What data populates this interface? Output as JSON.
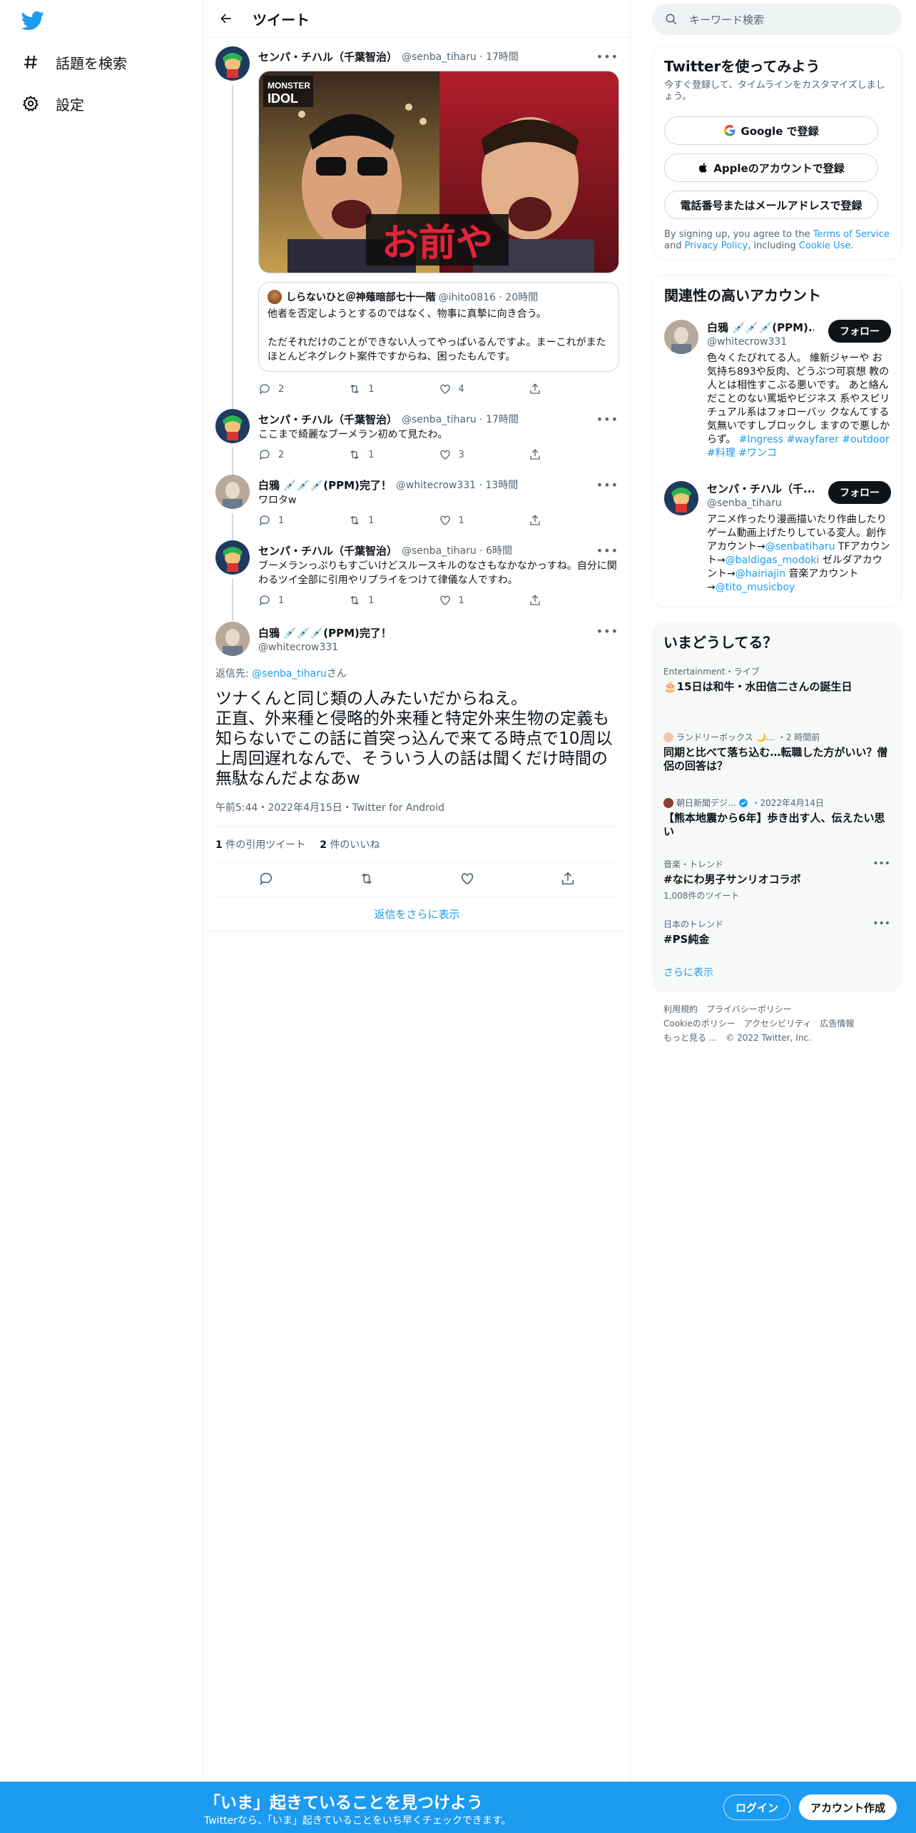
{
  "nav": {
    "logo": "twitter-bird",
    "items": [
      {
        "label": "話題を検索",
        "icon": "hashtag-icon"
      },
      {
        "label": "設定",
        "icon": "gear-icon"
      }
    ]
  },
  "header": {
    "title": "ツイート"
  },
  "thread": [
    {
      "name": "センパ・チハル（千葉智治）",
      "handle": "@senba_tiharu",
      "time": "17時間",
      "image_text": "お前や",
      "image_badge": "MONSTER IDOL",
      "quote": {
        "name": "しらないひと＠神薙暗部七十一階",
        "handle": "@ihito0816",
        "time": "20時間",
        "text": "他者を否定しようとするのではなく、物事に真摯に向き合う。\n\nただそれだけのことができない人ってやっぱいるんですよ。まーこれがまたほとんどネグレクト案件ですからね、困ったもんです。"
      },
      "replies": "2",
      "retweets": "1",
      "likes": "4"
    },
    {
      "name": "センパ・チハル（千葉智治）",
      "handle": "@senba_tiharu",
      "time": "17時間",
      "text": "ここまで綺麗なブーメラン初めて見たわ。",
      "replies": "2",
      "retweets": "1",
      "likes": "3"
    },
    {
      "name": "白鴉 💉💉💉(PPM)完了！",
      "handle": "@whitecrow331",
      "time": "13時間",
      "text": "ワロタw",
      "replies": "1",
      "retweets": "1",
      "likes": "1"
    },
    {
      "name": "センパ・チハル（千葉智治）",
      "handle": "@senba_tiharu",
      "time": "6時間",
      "text": "ブーメランっぷりもすごいけどスルースキルのなさもなかなかっすね。自分に関わるツイ全部に引用やリプライをつけて律儀な人ですわ。",
      "replies": "1",
      "retweets": "1",
      "likes": "1"
    }
  ],
  "focus": {
    "name": "白鴉 💉💉💉(PPM)完了！",
    "handle": "@whitecrow331",
    "reply_to_prefix": "返信先: ",
    "reply_to_handle": "@senba_tiharu",
    "reply_to_suffix": "さん",
    "text": "ツナくんと同じ類の人みたいだからねえ。\n正直、外来種と侵略的外来種と特定外来生物の定義も知らないでこの話に首突っ込んで来てる時点で10周以上周回遅れなんで、そういう人の話は聞くだけ時間の無駄なんだよなあw",
    "meta": "午前5:44・2022年4月15日・Twitter for Android",
    "quote_count": "1",
    "quote_label": "件の引用ツイート",
    "like_count": "2",
    "like_label": "件のいいね"
  },
  "show_more_replies": "返信をさらに表示",
  "right": {
    "search_placeholder": "キーワード検索",
    "signup": {
      "title": "Twitterを使ってみよう",
      "sub": "今すぐ登録して、タイムラインをカスタマイズしましょう。",
      "google": "Google で登録",
      "apple": "Appleのアカウントで登録",
      "phone": "電話番号またはメールアドレスで登録",
      "fine_1": "By signing up, you agree to the ",
      "terms": "Terms of Service",
      "fine_2": " and ",
      "privacy": "Privacy Policy",
      "fine_3": ", including ",
      "cookie": "Cookie Use",
      "fine_4": "."
    },
    "related": {
      "title": "関連性の高いアカウント",
      "follow_label": "フォロー",
      "accounts": [
        {
          "name": "白鴉 💉💉💉(PPM)...",
          "handle": "@whitecrow331",
          "bio": "色々くたびれてる人。 維新ジャーや お気持ち893や反肉、どうぶつ可哀想 教の人とは相性すこぶる悪いです。 あと絡んだことのない罵垢やビジネス 系やスピリチュアル系はフォローバッ クなんてする気無いですしブロックし ますので悪しからず。 ",
          "tags": "#Ingress #wayfarer #outdoor #料理 #ワンコ"
        },
        {
          "name": "センパ・チハル（千...",
          "handle": "@senba_tiharu",
          "bio_1": "アニメ作ったり漫画描いたり作曲したりゲーム動画上げたりしている変人。創作アカウント→",
          "link_1": "@senbatiharu",
          "bio_2": " TFアカウント→",
          "link_2": "@baldigas_modoki",
          "bio_3": " ゼルダアカウント→",
          "link_3": "@hairiajin",
          "bio_4": " 音楽アカウント→",
          "link_4": "@tito_musicboy"
        }
      ]
    },
    "trends": {
      "title": "いまどうしてる？",
      "items": [
        {
          "category": "Entertainment・ライブ",
          "title": "🎂15日は和牛・水田信二さんの誕生日"
        },
        {
          "category": "ランドリーボックス 🌙...",
          "time": "・2 時間前",
          "title": "同期と比べて落ち込む…転職した方がいい？僧侶の回答は？"
        },
        {
          "category": "朝日新聞デジ...",
          "time": "・2022年4月14日",
          "title": "【熊本地震から6年】歩き出す人、伝えたい思い"
        },
        {
          "category": "音楽・トレンド",
          "title": "#なにわ男子サンリオコラボ",
          "count": "1,008件のツイート"
        },
        {
          "category": "日本のトレンド",
          "title": "#PS純金"
        }
      ],
      "show_more": "さらに表示"
    },
    "footer": {
      "links": [
        "利用規約",
        "プライバシーポリシー",
        "Cookieのポリシー",
        "アクセシビリティ",
        "広告情報",
        "もっと見る ..."
      ],
      "copyright": "© 2022 Twitter, Inc."
    }
  },
  "banner": {
    "headline": "「いま」起きていることを見つけよう",
    "sub": "Twitterなら、「いま」起きていることをいち早くチェックできます。",
    "login": "ログイン",
    "signup": "アカウント作成"
  },
  "colors": {
    "brand": "#1d9bf0",
    "text": "#0f1419",
    "muted": "#536471"
  }
}
